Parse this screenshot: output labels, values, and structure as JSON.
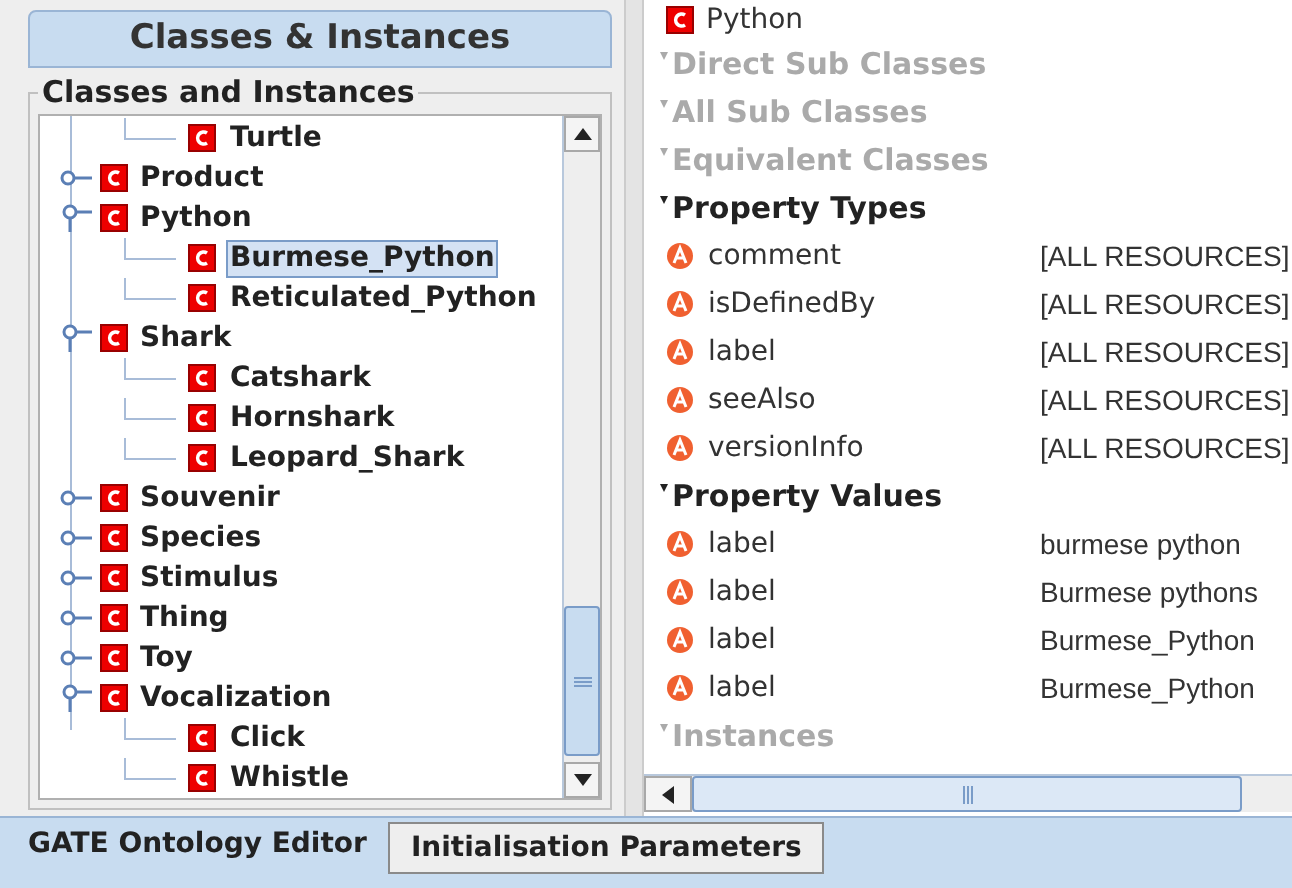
{
  "left_panel": {
    "tab": {
      "label": "Classes & Instances",
      "selected": true
    },
    "group_title": "Classes and Instances",
    "tree": {
      "continued_children": [
        {
          "label": "Turtle",
          "selected": false
        }
      ],
      "items": [
        {
          "label": "Product",
          "expanded": false,
          "selected": false
        },
        {
          "label": "Python",
          "expanded": true,
          "selected": false,
          "children": [
            {
              "label": "Burmese_Python",
              "selected": true
            },
            {
              "label": "Reticulated_Python",
              "selected": false
            }
          ]
        },
        {
          "label": "Shark",
          "expanded": true,
          "selected": false,
          "children": [
            {
              "label": "Catshark",
              "selected": false
            },
            {
              "label": "Hornshark",
              "selected": false
            },
            {
              "label": "Leopard_Shark",
              "selected": false
            }
          ]
        },
        {
          "label": "Souvenir",
          "expanded": false,
          "selected": false
        },
        {
          "label": "Species",
          "expanded": false,
          "selected": false
        },
        {
          "label": "Stimulus",
          "expanded": false,
          "selected": false
        },
        {
          "label": "Thing",
          "expanded": false,
          "selected": false
        },
        {
          "label": "Toy",
          "expanded": false,
          "selected": false
        },
        {
          "label": "Vocalization",
          "expanded": true,
          "selected": false,
          "children": [
            {
              "label": "Click",
              "selected": false
            },
            {
              "label": "Whistle",
              "selected": false
            }
          ]
        }
      ]
    }
  },
  "details": {
    "rows": [
      {
        "kind": "class",
        "label": "Python"
      },
      {
        "kind": "section",
        "label": "Direct Sub Classes",
        "enabled": false
      },
      {
        "kind": "section",
        "label": "All Sub Classes",
        "enabled": false
      },
      {
        "kind": "section",
        "label": "Equivalent Classes",
        "enabled": false
      },
      {
        "kind": "section",
        "label": "Property Types",
        "enabled": true
      },
      {
        "kind": "property",
        "name": "comment",
        "value": "[ALL RESOURCES]"
      },
      {
        "kind": "property",
        "name": "isDefinedBy",
        "value": "[ALL RESOURCES]"
      },
      {
        "kind": "property",
        "name": "label",
        "value": "[ALL RESOURCES]"
      },
      {
        "kind": "property",
        "name": "seeAlso",
        "value": "[ALL RESOURCES]"
      },
      {
        "kind": "property",
        "name": "versionInfo",
        "value": "[ALL RESOURCES]"
      },
      {
        "kind": "section",
        "label": "Property Values",
        "enabled": true
      },
      {
        "kind": "property",
        "name": "label",
        "value": "burmese python"
      },
      {
        "kind": "property",
        "name": "label",
        "value": "Burmese pythons"
      },
      {
        "kind": "property",
        "name": "label",
        "value": "Burmese_Python"
      },
      {
        "kind": "property",
        "name": "label",
        "value": "Burmese_Python"
      },
      {
        "kind": "section",
        "label": "Instances",
        "enabled": false
      }
    ]
  },
  "bottom_tabs": [
    {
      "label": "GATE Ontology Editor",
      "selected": true
    },
    {
      "label": "Initialisation Parameters",
      "selected": false
    }
  ]
}
